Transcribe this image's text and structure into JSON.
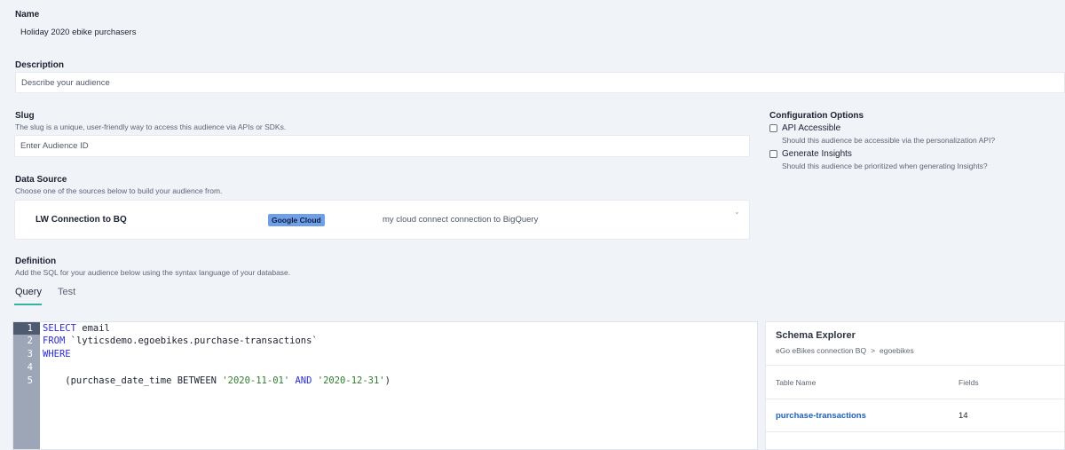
{
  "name": {
    "label": "Name",
    "value": "Holiday 2020 ebike purchasers"
  },
  "description": {
    "label": "Description",
    "placeholder": "Describe your audience"
  },
  "slug": {
    "label": "Slug",
    "help": "The slug is a unique, user-friendly way to access this audience via APIs or SDKs.",
    "placeholder": "Enter Audience ID"
  },
  "config": {
    "label": "Configuration Options",
    "options": [
      {
        "label": "API Accessible",
        "help": "Should this audience be accessible via the personalization API?",
        "checked": false
      },
      {
        "label": "Generate Insights",
        "help": "Should this audience be prioritized when generating Insights?",
        "checked": false
      }
    ]
  },
  "data_source": {
    "label": "Data Source",
    "help": "Choose one of the sources below to build your audience from.",
    "selected": {
      "name": "LW Connection to BQ",
      "badge": "Google Cloud",
      "description": "my cloud connect connection to BigQuery"
    },
    "chevron_icon": "chevron-down-icon"
  },
  "definition": {
    "label": "Definition",
    "help": "Add the SQL for your audience below using the syntax language of your database.",
    "tabs": [
      {
        "label": "Query",
        "active": true
      },
      {
        "label": "Test",
        "active": false
      }
    ]
  },
  "editor": {
    "line_numbers": [
      "1",
      "2",
      "3",
      "4",
      "5"
    ],
    "line1": {
      "kw": "SELECT",
      "rest": " email"
    },
    "line2": {
      "kw": "FROM",
      "rest": " `lyticsdemo.egoebikes.purchase-transactions`"
    },
    "line3": {
      "kw": "WHERE"
    },
    "line5": {
      "a": "    (purchase_date_time BETWEEN ",
      "s1": "'2020-11-01'",
      "kw": " AND ",
      "s2": "'2020-12-31'",
      "b": ")"
    },
    "colors": {
      "keyword": "#2b2bd6",
      "string": "#2f7b2f",
      "gutter": "#9ca6b6"
    }
  },
  "schema_explorer": {
    "title": "Schema Explorer",
    "breadcrumb": [
      "eGo eBikes connection BQ",
      ">",
      "egoebikes"
    ],
    "columns": [
      "Table Name",
      "Fields"
    ],
    "rows": [
      {
        "table": "purchase-transactions",
        "fields": "14"
      }
    ]
  }
}
